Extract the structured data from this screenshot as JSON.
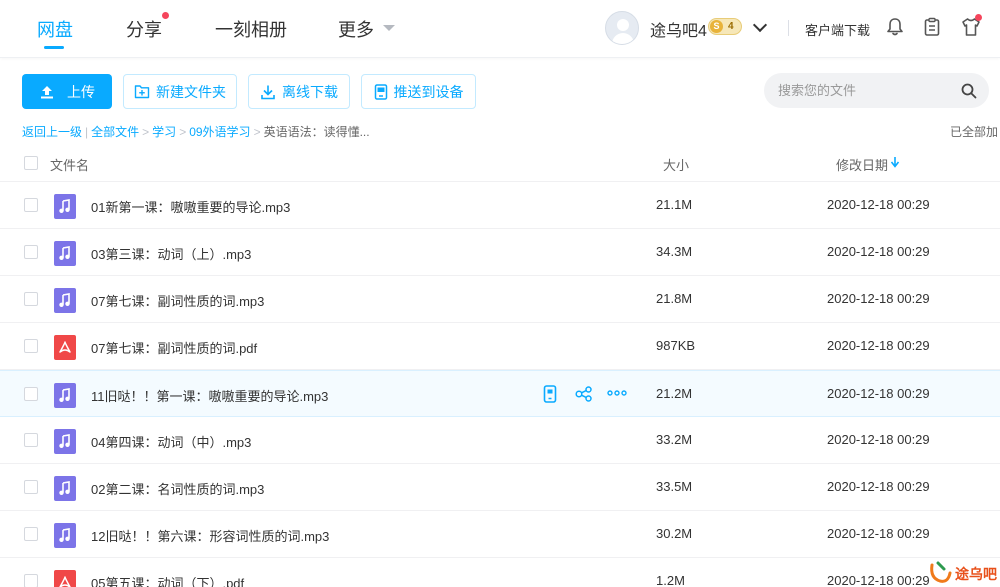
{
  "nav": {
    "items": [
      {
        "label": "网盘"
      },
      {
        "label": "分享"
      },
      {
        "label": "一刻相册"
      },
      {
        "label": "更多"
      }
    ]
  },
  "user": {
    "name": "途乌吧4",
    "vip_coin": "S",
    "vip_level": "4"
  },
  "header_links": {
    "client_download": "客户端下载"
  },
  "toolbar": {
    "upload": "上传",
    "new_folder": "新建文件夹",
    "offline_download": "离线下载",
    "push_device": "推送到设备"
  },
  "search": {
    "placeholder": "搜索您的文件"
  },
  "breadcrumb": {
    "back": "返回上一级",
    "all": "全部文件",
    "level1": "学习",
    "level2": "09外语学习",
    "current": "英语语法：读得懂..."
  },
  "loaded_status": "已全部加",
  "columns": {
    "name": "文件名",
    "size": "大小",
    "date": "修改日期"
  },
  "files": [
    {
      "name": "01新第一课：嗷嗷重要的导论.mp3",
      "size": "21.1M",
      "date": "2020-12-18 00:29",
      "type": "audio"
    },
    {
      "name": "03第三课：动词（上）.mp3",
      "size": "34.3M",
      "date": "2020-12-18 00:29",
      "type": "audio"
    },
    {
      "name": "07第七课：副词性质的词.mp3",
      "size": "21.8M",
      "date": "2020-12-18 00:29",
      "type": "audio"
    },
    {
      "name": "07第七课：副词性质的词.pdf",
      "size": "987KB",
      "date": "2020-12-18 00:29",
      "type": "pdf"
    },
    {
      "name": "11旧哒！！第一课：嗷嗷重要的导论.mp3",
      "size": "21.2M",
      "date": "2020-12-18 00:29",
      "type": "audio"
    },
    {
      "name": "04第四课：动词（中）.mp3",
      "size": "33.2M",
      "date": "2020-12-18 00:29",
      "type": "audio"
    },
    {
      "name": "02第二课：名词性质的词.mp3",
      "size": "33.5M",
      "date": "2020-12-18 00:29",
      "type": "audio"
    },
    {
      "name": "12旧哒！！第六课：形容词性质的词.mp3",
      "size": "30.2M",
      "date": "2020-12-18 00:29",
      "type": "audio"
    },
    {
      "name": "05第五课：动词（下）.pdf",
      "size": "1.2M",
      "date": "2020-12-18 00:29",
      "type": "pdf"
    }
  ],
  "watermark": {
    "text": "途乌吧"
  },
  "colors": {
    "accent": "#09aaff",
    "audio_icon": "#7c74e8",
    "pdf_icon": "#f04848"
  }
}
